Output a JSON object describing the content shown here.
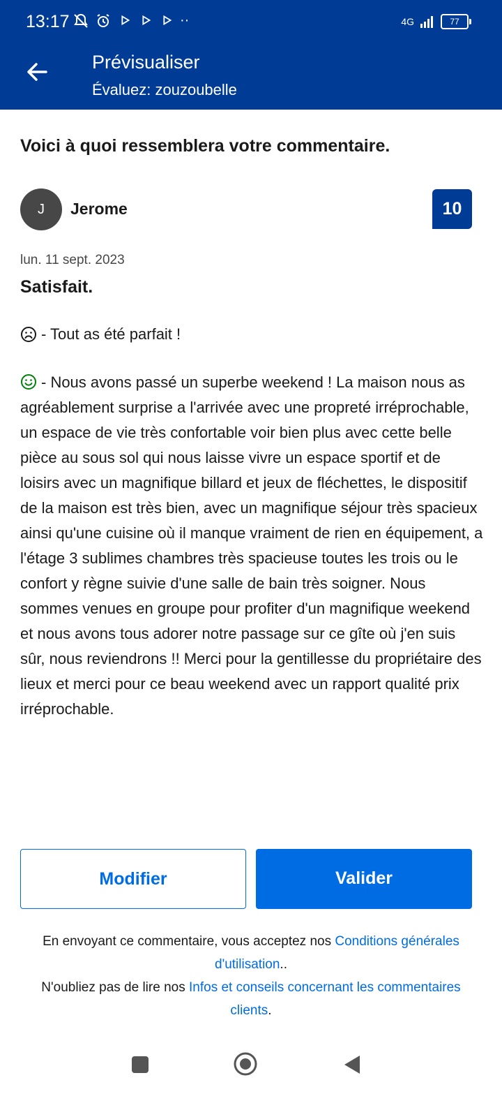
{
  "status_bar": {
    "time": "13:17",
    "network": "4G",
    "battery": "77"
  },
  "header": {
    "title": "Prévisualiser",
    "subtitle": "Évaluez: zouzoubelle",
    "background_color": "#003b95"
  },
  "preview": {
    "intro": "Voici à quoi ressemblera votre commentaire."
  },
  "review": {
    "avatar_initial": "J",
    "reviewer_name": "Jerome",
    "score": "10",
    "date": "lun. 11 sept. 2023",
    "title": "Satisfait.",
    "negative_text": "- Tout as été parfait !",
    "positive_text": "- Nous avons passé un superbe weekend ! La maison nous as agréablement surprise a l'arrivée avec une propreté irréprochable, un espace de vie très confortable voir bien plus avec cette belle pièce au sous sol qui nous laisse vivre un espace sportif et de loisirs avec un magnifique billard et jeux de fléchettes, le dispositif de la maison est très bien,  avec un magnifique séjour très spacieux ainsi qu'une cuisine où il manque vraiment de rien en équipement, a l'étage 3 sublimes chambres très spacieuse toutes les trois ou le confort y règne suivie d'une salle de bain très soigner. Nous sommes venues en groupe pour profiter d'un magnifique weekend et nous avons tous adorer notre passage sur ce gîte où j'en suis sûr, nous reviendrons !! Merci pour la gentillesse du propriétaire des lieux et merci pour ce beau weekend avec un rapport qualité prix irréprochable.",
    "negative_icon": "sad-face-icon",
    "positive_icon": "smile-face-icon"
  },
  "actions": {
    "modify_label": "Modifier",
    "validate_label": "Valider",
    "accent_color": "#006ce4"
  },
  "legal": {
    "line1_text": "En envoyant ce commentaire, vous acceptez nos ",
    "line1_link": "Conditions générales d'utilisation",
    "line1_end": "..",
    "line2_text": "N'oubliez pas de lire nos ",
    "line2_link": "Infos et conseils concernant les commentaires clients",
    "line2_end": "."
  },
  "nav_bar": {
    "icons": [
      "recents-icon",
      "home-icon",
      "back-icon"
    ]
  }
}
